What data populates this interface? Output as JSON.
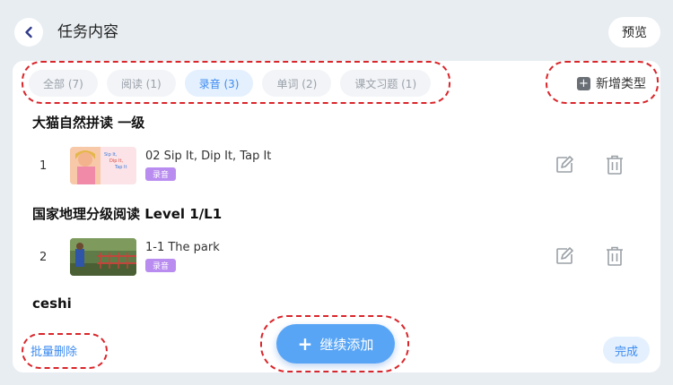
{
  "header": {
    "title": "任务内容",
    "preview_label": "预览"
  },
  "tabs": [
    {
      "label": "全部 (7)",
      "active": false
    },
    {
      "label": "阅读 (1)",
      "active": false
    },
    {
      "label": "录音 (3)",
      "active": true
    },
    {
      "label": "单词 (2)",
      "active": false
    },
    {
      "label": "课文习题 (1)",
      "active": false
    }
  ],
  "add_type_label": "新增类型",
  "sections": [
    {
      "title": "大猫自然拼读 一级",
      "items": [
        {
          "index": "1",
          "name": "02 Sip It, Dip It, Tap It",
          "badge": "录音"
        }
      ]
    },
    {
      "title": "国家地理分级阅读 Level 1/L1",
      "items": [
        {
          "index": "2",
          "name": "1-1 The park",
          "badge": "录音"
        }
      ]
    },
    {
      "title": "ceshi",
      "items": []
    }
  ],
  "footer": {
    "batch_delete_label": "批量删除",
    "continue_label": "继续添加",
    "done_label": "完成"
  },
  "colors": {
    "accent": "#3d8bf0",
    "primary_button": "#58a5f6",
    "badge": "#b98cf0",
    "annotation_dash": "#d9262b"
  }
}
